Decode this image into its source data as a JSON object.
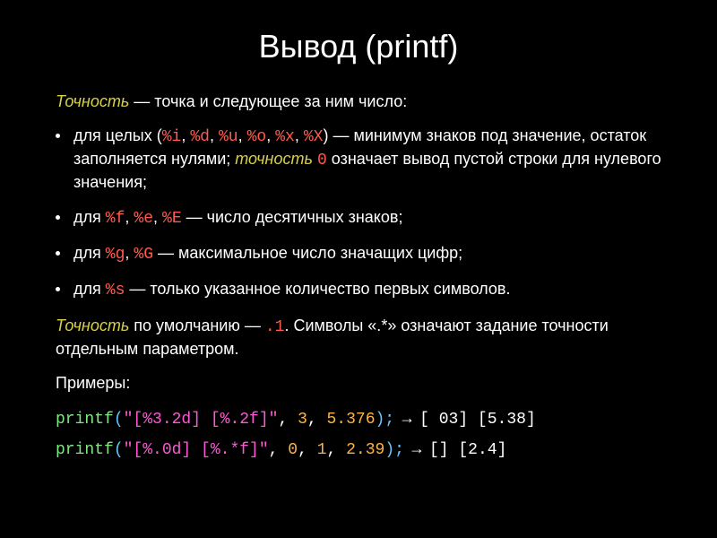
{
  "title": "Вывод (printf)",
  "term_precision": "Точность",
  "term_precision2": "точность",
  "intro_tail": " — точка и следующее за ним число:",
  "b1": {
    "pre": "для целых (",
    "sp1": "%i",
    "sp2": "%d",
    "sp3": "%u",
    "sp4": "%o",
    "sp5": "%x",
    "sp6": "%X",
    "mid": ") — минимум знаков под значение, остаток заполняется нулями; ",
    "zero": "0",
    "tail": " означает вывод пустой строки для нулевого значения;"
  },
  "b2": {
    "pre": "для ",
    "sp1": "%f",
    "sp2": "%e",
    "sp3": "%E",
    "tail": " — число десятичных знаков;"
  },
  "b3": {
    "pre": "для ",
    "sp1": "%g",
    "sp2": "%G",
    "tail": " — максимальное число значащих цифр;"
  },
  "b4": {
    "pre": "для ",
    "sp1": "%s",
    "tail": " — только указанное количество первых символов."
  },
  "default_line": {
    "mid": " по умолчанию — ",
    "val": ".1",
    "tail": ". Символы «.*» означают задание точности отдельным параметром."
  },
  "examples_label": "Примеры:",
  "ex1": {
    "fn": "printf",
    "open": "(",
    "str": "\"[%3.2d] [%.2f]\"",
    "sep1": ", ",
    "n1": "3",
    "sep2": ", ",
    "n2": "5.376",
    "close": ");",
    "arrow": " → ",
    "out": "[ 03] [5.38]"
  },
  "ex2": {
    "fn": "printf",
    "open": "(",
    "str": "\"[%.0d] [%.*f]\"",
    "sep1": ", ",
    "n1": "0",
    "sep2": ", ",
    "n2": "1",
    "sep3": ", ",
    "n3": "2.39",
    "close": ");",
    "arrow": " → ",
    "out": "[] [2.4]"
  }
}
